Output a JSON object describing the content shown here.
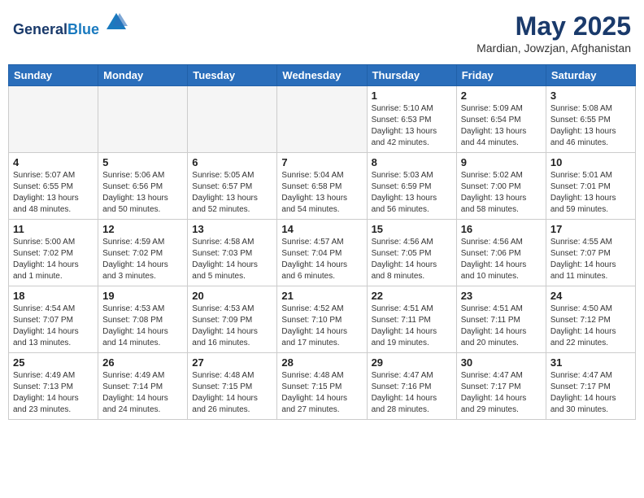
{
  "header": {
    "logo_general": "General",
    "logo_blue": "Blue",
    "month_title": "May 2025",
    "location": "Mardian, Jowzjan, Afghanistan"
  },
  "weekdays": [
    "Sunday",
    "Monday",
    "Tuesday",
    "Wednesday",
    "Thursday",
    "Friday",
    "Saturday"
  ],
  "weeks": [
    [
      {
        "day": "",
        "info": ""
      },
      {
        "day": "",
        "info": ""
      },
      {
        "day": "",
        "info": ""
      },
      {
        "day": "",
        "info": ""
      },
      {
        "day": "1",
        "info": "Sunrise: 5:10 AM\nSunset: 6:53 PM\nDaylight: 13 hours\nand 42 minutes."
      },
      {
        "day": "2",
        "info": "Sunrise: 5:09 AM\nSunset: 6:54 PM\nDaylight: 13 hours\nand 44 minutes."
      },
      {
        "day": "3",
        "info": "Sunrise: 5:08 AM\nSunset: 6:55 PM\nDaylight: 13 hours\nand 46 minutes."
      }
    ],
    [
      {
        "day": "4",
        "info": "Sunrise: 5:07 AM\nSunset: 6:55 PM\nDaylight: 13 hours\nand 48 minutes."
      },
      {
        "day": "5",
        "info": "Sunrise: 5:06 AM\nSunset: 6:56 PM\nDaylight: 13 hours\nand 50 minutes."
      },
      {
        "day": "6",
        "info": "Sunrise: 5:05 AM\nSunset: 6:57 PM\nDaylight: 13 hours\nand 52 minutes."
      },
      {
        "day": "7",
        "info": "Sunrise: 5:04 AM\nSunset: 6:58 PM\nDaylight: 13 hours\nand 54 minutes."
      },
      {
        "day": "8",
        "info": "Sunrise: 5:03 AM\nSunset: 6:59 PM\nDaylight: 13 hours\nand 56 minutes."
      },
      {
        "day": "9",
        "info": "Sunrise: 5:02 AM\nSunset: 7:00 PM\nDaylight: 13 hours\nand 58 minutes."
      },
      {
        "day": "10",
        "info": "Sunrise: 5:01 AM\nSunset: 7:01 PM\nDaylight: 13 hours\nand 59 minutes."
      }
    ],
    [
      {
        "day": "11",
        "info": "Sunrise: 5:00 AM\nSunset: 7:02 PM\nDaylight: 14 hours\nand 1 minute."
      },
      {
        "day": "12",
        "info": "Sunrise: 4:59 AM\nSunset: 7:02 PM\nDaylight: 14 hours\nand 3 minutes."
      },
      {
        "day": "13",
        "info": "Sunrise: 4:58 AM\nSunset: 7:03 PM\nDaylight: 14 hours\nand 5 minutes."
      },
      {
        "day": "14",
        "info": "Sunrise: 4:57 AM\nSunset: 7:04 PM\nDaylight: 14 hours\nand 6 minutes."
      },
      {
        "day": "15",
        "info": "Sunrise: 4:56 AM\nSunset: 7:05 PM\nDaylight: 14 hours\nand 8 minutes."
      },
      {
        "day": "16",
        "info": "Sunrise: 4:56 AM\nSunset: 7:06 PM\nDaylight: 14 hours\nand 10 minutes."
      },
      {
        "day": "17",
        "info": "Sunrise: 4:55 AM\nSunset: 7:07 PM\nDaylight: 14 hours\nand 11 minutes."
      }
    ],
    [
      {
        "day": "18",
        "info": "Sunrise: 4:54 AM\nSunset: 7:07 PM\nDaylight: 14 hours\nand 13 minutes."
      },
      {
        "day": "19",
        "info": "Sunrise: 4:53 AM\nSunset: 7:08 PM\nDaylight: 14 hours\nand 14 minutes."
      },
      {
        "day": "20",
        "info": "Sunrise: 4:53 AM\nSunset: 7:09 PM\nDaylight: 14 hours\nand 16 minutes."
      },
      {
        "day": "21",
        "info": "Sunrise: 4:52 AM\nSunset: 7:10 PM\nDaylight: 14 hours\nand 17 minutes."
      },
      {
        "day": "22",
        "info": "Sunrise: 4:51 AM\nSunset: 7:11 PM\nDaylight: 14 hours\nand 19 minutes."
      },
      {
        "day": "23",
        "info": "Sunrise: 4:51 AM\nSunset: 7:11 PM\nDaylight: 14 hours\nand 20 minutes."
      },
      {
        "day": "24",
        "info": "Sunrise: 4:50 AM\nSunset: 7:12 PM\nDaylight: 14 hours\nand 22 minutes."
      }
    ],
    [
      {
        "day": "25",
        "info": "Sunrise: 4:49 AM\nSunset: 7:13 PM\nDaylight: 14 hours\nand 23 minutes."
      },
      {
        "day": "26",
        "info": "Sunrise: 4:49 AM\nSunset: 7:14 PM\nDaylight: 14 hours\nand 24 minutes."
      },
      {
        "day": "27",
        "info": "Sunrise: 4:48 AM\nSunset: 7:15 PM\nDaylight: 14 hours\nand 26 minutes."
      },
      {
        "day": "28",
        "info": "Sunrise: 4:48 AM\nSunset: 7:15 PM\nDaylight: 14 hours\nand 27 minutes."
      },
      {
        "day": "29",
        "info": "Sunrise: 4:47 AM\nSunset: 7:16 PM\nDaylight: 14 hours\nand 28 minutes."
      },
      {
        "day": "30",
        "info": "Sunrise: 4:47 AM\nSunset: 7:17 PM\nDaylight: 14 hours\nand 29 minutes."
      },
      {
        "day": "31",
        "info": "Sunrise: 4:47 AM\nSunset: 7:17 PM\nDaylight: 14 hours\nand 30 minutes."
      }
    ]
  ]
}
